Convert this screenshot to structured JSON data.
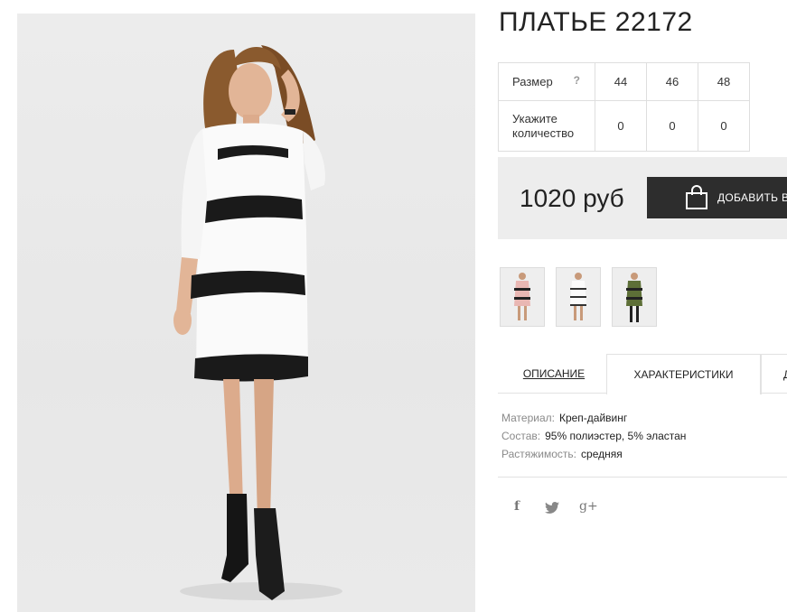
{
  "product": {
    "title": "ПЛАТЬЕ 22172",
    "price": "1020 руб",
    "add_to_cart_label": "ДОБАВИТЬ В"
  },
  "size_table": {
    "size_label": "Размер",
    "help_mark": "?",
    "sizes": [
      "44",
      "46",
      "48"
    ],
    "qty_label": "Укажите количество",
    "quantities": [
      "0",
      "0",
      "0"
    ]
  },
  "thumbnails": [
    {
      "name": "thumb-pink-dress",
      "color": "#e9b7b3"
    },
    {
      "name": "thumb-white-dress",
      "color": "#f4f4f4"
    },
    {
      "name": "thumb-green-dress",
      "color": "#5d6f37"
    }
  ],
  "tabs": {
    "description": "ОПИСАНИЕ",
    "characteristics": "ХАРАКТЕРИСТИКИ",
    "more": "Д"
  },
  "characteristics": [
    {
      "key": "Материал:",
      "value": "Креп-дайвинг"
    },
    {
      "key": "Состав:",
      "value": "95% полиэстер, 5% эластан"
    },
    {
      "key": "Растяжимость:",
      "value": "средняя"
    }
  ],
  "social": {
    "facebook": "f",
    "twitter": "twitter-bird-icon",
    "google_plus": "g+"
  },
  "colors": {
    "button_bg": "#2d2d2d",
    "price_bar_bg": "#ededed",
    "border": "#dedede"
  }
}
